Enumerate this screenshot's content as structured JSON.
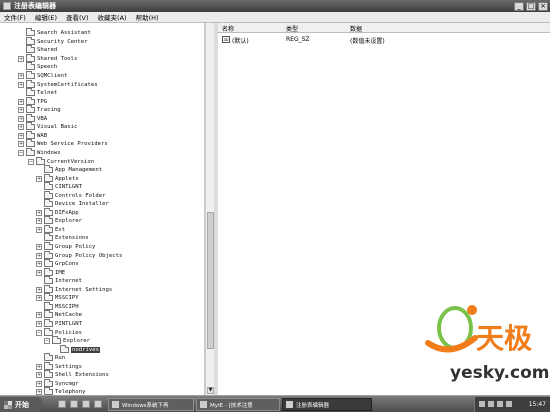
{
  "window": {
    "title": "注册表编辑器",
    "controls": [
      "_",
      "□",
      "×"
    ]
  },
  "menu": [
    "文件(F)",
    "编辑(E)",
    "查看(V)",
    "收藏夹(A)",
    "帮助(H)"
  ],
  "tree": [
    {
      "label": "Search Assistant",
      "level": 4,
      "expander": "none"
    },
    {
      "label": "Security Center",
      "level": 4,
      "expander": "none"
    },
    {
      "label": "Shared",
      "level": 4,
      "expander": "none"
    },
    {
      "label": "Shared Tools",
      "level": 4,
      "expander": "plus"
    },
    {
      "label": "Speech",
      "level": 4,
      "expander": "none"
    },
    {
      "label": "SQMClient",
      "level": 4,
      "expander": "plus"
    },
    {
      "label": "SystemCertificates",
      "level": 4,
      "expander": "plus"
    },
    {
      "label": "Telnet",
      "level": 4,
      "expander": "none"
    },
    {
      "label": "TPG",
      "level": 4,
      "expander": "plus"
    },
    {
      "label": "Tracing",
      "level": 4,
      "expander": "plus"
    },
    {
      "label": "VBA",
      "level": 4,
      "expander": "plus"
    },
    {
      "label": "Visual Basic",
      "level": 4,
      "expander": "plus"
    },
    {
      "label": "WAB",
      "level": 4,
      "expander": "plus"
    },
    {
      "label": "Web Service Providers",
      "level": 4,
      "expander": "plus"
    },
    {
      "label": "Windows",
      "level": 4,
      "expander": "minus"
    },
    {
      "label": "CurrentVersion",
      "level": 5,
      "expander": "minus"
    },
    {
      "label": "App Management",
      "level": 6,
      "expander": "none"
    },
    {
      "label": "Applets",
      "level": 6,
      "expander": "plus"
    },
    {
      "label": "CINTLGNT",
      "level": 6,
      "expander": "none"
    },
    {
      "label": "Controls Folder",
      "level": 6,
      "expander": "none"
    },
    {
      "label": "Device Installer",
      "level": 6,
      "expander": "none"
    },
    {
      "label": "DIFxApp",
      "level": 6,
      "expander": "plus"
    },
    {
      "label": "Explorer",
      "level": 6,
      "expander": "plus"
    },
    {
      "label": "Ext",
      "level": 6,
      "expander": "plus"
    },
    {
      "label": "Extensions",
      "level": 6,
      "expander": "none"
    },
    {
      "label": "Group Policy",
      "level": 6,
      "expander": "plus"
    },
    {
      "label": "Group Policy Objects",
      "level": 6,
      "expander": "plus"
    },
    {
      "label": "GrpConv",
      "level": 6,
      "expander": "plus"
    },
    {
      "label": "IME",
      "level": 6,
      "expander": "plus"
    },
    {
      "label": "Internet",
      "level": 6,
      "expander": "none"
    },
    {
      "label": "Internet Settings",
      "level": 6,
      "expander": "plus"
    },
    {
      "label": "MSSCIPY",
      "level": 6,
      "expander": "plus"
    },
    {
      "label": "MSSCIPH",
      "level": 6,
      "expander": "none"
    },
    {
      "label": "NetCache",
      "level": 6,
      "expander": "plus"
    },
    {
      "label": "PINTLGNT",
      "level": 6,
      "expander": "plus"
    },
    {
      "label": "Policies",
      "level": 6,
      "expander": "minus"
    },
    {
      "label": "Explorer",
      "level": 7,
      "expander": "minus"
    },
    {
      "label": "nodrives",
      "level": 8,
      "expander": "none",
      "selected": true
    },
    {
      "label": "Run",
      "level": 6,
      "expander": "none"
    },
    {
      "label": "Settings",
      "level": 6,
      "expander": "plus"
    },
    {
      "label": "Shell Extensions",
      "level": 6,
      "expander": "plus"
    },
    {
      "label": "Syncmgr",
      "level": 6,
      "expander": "plus"
    },
    {
      "label": "Telephony",
      "level": 6,
      "expander": "plus"
    }
  ],
  "values_pane": {
    "columns": {
      "name": "名称",
      "type": "类型",
      "data": "数据"
    },
    "rows": [
      {
        "name": "(默认)",
        "type": "REG_SZ",
        "data": "(数值未设置)",
        "icon": "ab-icon"
      }
    ]
  },
  "watermark": {
    "brand": "天极",
    "site": "yesky.com"
  },
  "colors": {
    "watermark_orange": "#f07d1a",
    "watermark_green": "#7cc24a"
  },
  "taskbar": {
    "start_label": "开始",
    "tasks": [
      {
        "label": "Windows系统下再",
        "active": false
      },
      {
        "label": "MyIE - [技术注意",
        "active": false
      },
      {
        "label": "注册表编辑器",
        "active": true
      }
    ],
    "clock": "15:47"
  }
}
